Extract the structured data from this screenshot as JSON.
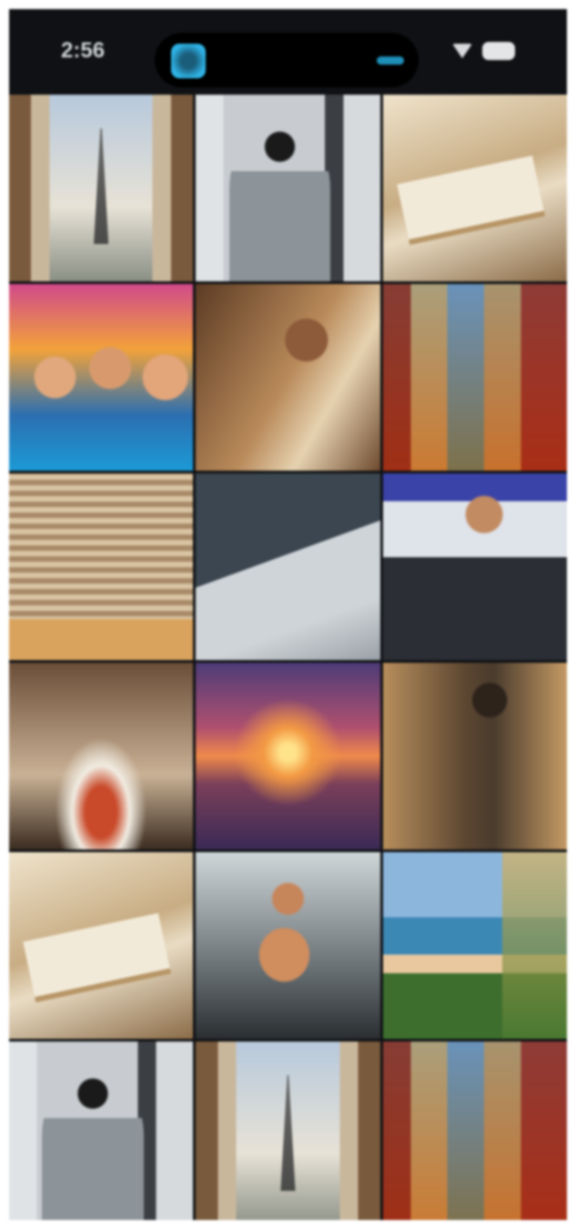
{
  "status_bar": {
    "time": "2:56",
    "icons": [
      "app-activity-icon",
      "wifi-icon",
      "battery-icon"
    ],
    "accent_color": "#2fb3e6"
  },
  "gallery": {
    "rows": 6,
    "columns": 3,
    "photo_count": 18
  }
}
